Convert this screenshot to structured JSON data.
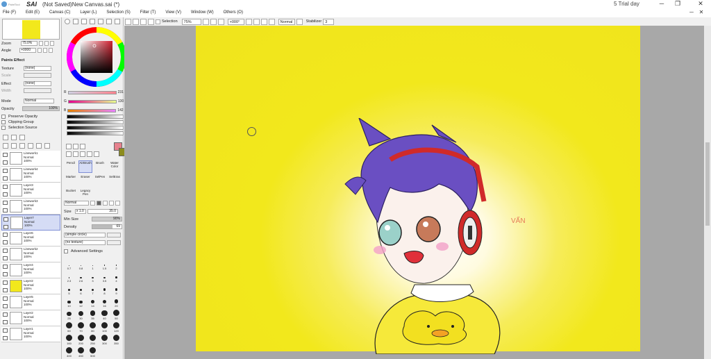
{
  "window": {
    "logo_small": "PaintTool",
    "app_name": "SAI",
    "title": "(Not Saved)New Canvas.sai (*)",
    "trial": "5 Trial day",
    "minimize": "─",
    "maximize": "❐",
    "close": "✕",
    "doc_min": "─",
    "doc_close": "✕"
  },
  "menu": [
    "File (F)",
    "Edit (E)",
    "Canvas (C)",
    "Layer (L)",
    "Selection (S)",
    "Filter (T)",
    "View (V)",
    "Window (W)",
    "Others (O)"
  ],
  "toolbar": {
    "selection_label": "Selection",
    "zoom": "75%",
    "rotation": "+000°",
    "blend_mode": "Normal",
    "stabilizer_label": "Stabilizer",
    "stabilizer_value": "3"
  },
  "navigator": {
    "zoom_label": "Zoom",
    "zoom_value": "75.0%",
    "angle_label": "Angle",
    "angle_value": "+0000"
  },
  "paint_effect": {
    "header": "Paints Effect",
    "texture_label": "Texture",
    "texture_value": "(none)",
    "scale_label": "Scale",
    "effect_label": "Effect",
    "effect_value": "(none)",
    "width_label": "Width",
    "mode_label": "Mode",
    "mode_value": "Normal",
    "opacity_label": "Opacity",
    "opacity_value": "100%",
    "preserve_opacity": "Preserve Opacity",
    "clipping_group": "Clipping Group",
    "selection_source": "Selection Source"
  },
  "layers": [
    {
      "name": "Linework1",
      "mode": "Normal",
      "opacity": "100%"
    },
    {
      "name": "Linework4",
      "mode": "Normal",
      "opacity": "100%"
    },
    {
      "name": "Layer3",
      "mode": "Normal",
      "opacity": "100%"
    },
    {
      "name": "Linework3",
      "mode": "Normal",
      "opacity": "100%"
    },
    {
      "name": "Layer7",
      "mode": "Normal",
      "opacity": "100%"
    },
    {
      "name": "Layer6",
      "mode": "Normal",
      "opacity": "100%"
    },
    {
      "name": "Linework2",
      "mode": "Normal",
      "opacity": "100%"
    },
    {
      "name": "Layer4",
      "mode": "Normal",
      "opacity": "100%"
    },
    {
      "name": "Layer2",
      "mode": "Normal",
      "opacity": "100%"
    },
    {
      "name": "Layer5",
      "mode": "Normal",
      "opacity": "100%"
    },
    {
      "name": "Layer2",
      "mode": "Normal",
      "opacity": "100%"
    },
    {
      "name": "Layer1",
      "mode": "Normal",
      "opacity": "100%"
    }
  ],
  "color": {
    "r_label": "R",
    "r_value": "231",
    "g_label": "G",
    "g_value": "130",
    "b_label": "B",
    "b_value": "142",
    "main_color": "#e7828e",
    "secondary_color": "#8c8c1e"
  },
  "tools": {
    "row1": [
      "Pencil",
      "AirBrush",
      "Brush",
      "Water Color"
    ],
    "row2": [
      "Marker",
      "Eraser",
      "SelPen",
      "SelEras"
    ],
    "row3": [
      "Bucket",
      "Legacy Pen"
    ]
  },
  "brush": {
    "blend": "Normal",
    "size_label": "Size",
    "size_mult": "x 1.0",
    "size_value": "35.0",
    "min_size_label": "Min Size",
    "min_size_value": "90%",
    "density_label": "Density",
    "density_value": "69",
    "shape": "(simple circle)",
    "texture": "(no texture)",
    "advanced": "Advanced Settings",
    "sizes": [
      "0.7",
      "0.8",
      "1",
      "1.5",
      "2",
      "2.3",
      "2.6",
      "3",
      "3.5",
      "4",
      "5",
      "6",
      "7",
      "8",
      "9",
      "10",
      "12",
      "14",
      "16",
      "20",
      "25",
      "30",
      "35",
      "40",
      "50",
      "60",
      "70",
      "80",
      "100",
      "120",
      "160",
      "200",
      "250",
      "300",
      "350",
      "400",
      "450",
      "500"
    ]
  },
  "canvas": {
    "signature": "VẤN"
  }
}
